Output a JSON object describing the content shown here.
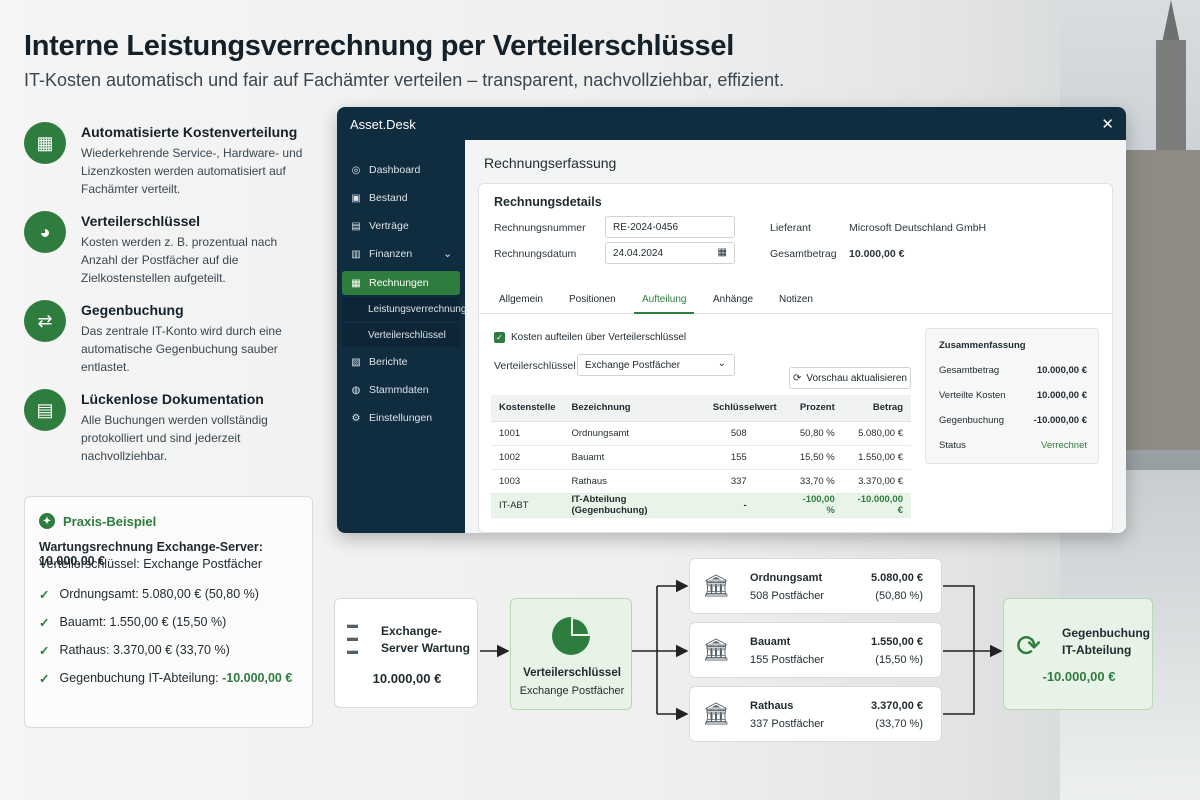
{
  "title": "Interne Leistungsverrechnung per Verteilerschlüssel",
  "subtitle": "IT-Kosten automatisch und fair auf Fachämter verteilen – transparent, nachvollziehbar, effizient.",
  "features": [
    {
      "title": "Automatisierte Kostenverteilung",
      "desc": "Wiederkehrende Service-, Hardware- und Lizenzkosten werden automatisiert auf Fachämter verteilt."
    },
    {
      "title": "Verteilerschlüssel",
      "desc": "Kosten werden z. B. prozentual nach Anzahl der Postfächer auf die Zielkostenstellen aufgeteilt."
    },
    {
      "title": "Gegenbuchung",
      "desc": "Das zentrale IT-Konto wird durch eine automatische Gegenbuchung sauber entlastet."
    },
    {
      "title": "Lückenlose Dokumentation",
      "desc": "Alle Buchungen werden vollständig protokolliert und sind jederzeit nachvollziehbar."
    }
  ],
  "example": {
    "heading": "Praxis-Beispiel",
    "line1": "Wartungsrechnung Exchange-Server: 10.000,00 €",
    "line2": "Verteilerschlüssel: Exchange Postfächer",
    "items": [
      "Ordnungsamt: 5.080,00 € (50,80 %)",
      "Bauamt: 1.550,00 € (15,50 %)",
      "Rathaus: 3.370,00 € (33,70 %)"
    ],
    "last_prefix": "Gegenbuchung IT-Abteilung: ",
    "last_value": "-10.000,00 €"
  },
  "app": {
    "name": "Asset.Desk",
    "close": "✕",
    "nav": [
      "Dashboard",
      "Bestand",
      "Verträge",
      "Finanzen",
      "Rechnungen",
      "Berichte",
      "Stammdaten",
      "Einstellungen"
    ],
    "subnav": [
      "Leistungsverrechnung",
      "Verteilerschlüssel"
    ],
    "page_title": "Rechnungserfassung",
    "card_title": "Rechnungsdetails",
    "lbl_nr": "Rechnungsnummer",
    "val_nr": "RE-2024-0456",
    "lbl_datum": "Rechnungsdatum",
    "val_datum": "24.04.2024",
    "lbl_lief": "Lieferant",
    "val_lief": "Microsoft Deutschland GmbH",
    "lbl_ges": "Gesamtbetrag",
    "val_ges": "10.000,00 €",
    "tabs": [
      "Allgemein",
      "Positionen",
      "Aufteilung",
      "Anhänge",
      "Notizen"
    ],
    "checkbox": "Kosten aufteilen über Verteilerschlüssel",
    "lbl_key": "Verteilerschlüssel",
    "val_key": "Exchange Postfächer",
    "refresh": "Vorschau aktualisieren",
    "table": {
      "headers": [
        "Kostenstelle",
        "Bezeichnung",
        "Schlüsselwert",
        "Prozent",
        "Betrag"
      ],
      "rows": [
        [
          "1001",
          "Ordnungsamt",
          "508",
          "50,80 %",
          "5.080,00 €"
        ],
        [
          "1002",
          "Bauamt",
          "155",
          "15,50 %",
          "1.550,00 €"
        ],
        [
          "1003",
          "Rathaus",
          "337",
          "33,70 %",
          "3.370,00 €"
        ],
        [
          "IT-ABT",
          "IT-Abteilung (Gegenbuchung)",
          "-",
          "-100,00 %",
          "-10.000,00 €"
        ]
      ]
    },
    "summary": {
      "title": "Zusammenfassung",
      "rows": [
        [
          "Gesamtbetrag",
          "10.000,00 €"
        ],
        [
          "Verteilte Kosten",
          "10.000,00 €"
        ],
        [
          "Gegenbuchung",
          "-10.000,00 €"
        ],
        [
          "Status",
          "Verrechnet"
        ]
      ]
    }
  },
  "flow": {
    "src_title": "Exchange-Server Wartung",
    "src_amount": "10.000,00 €",
    "key_title": "Verteilerschlüssel",
    "key_sub": "Exchange Postfächer",
    "targets": [
      {
        "name": "Ordnungsamt",
        "boxes": "508 Postfächer",
        "amount": "5.080,00 €",
        "pct": "(50,80 %)"
      },
      {
        "name": "Bauamt",
        "boxes": "155 Postfächer",
        "amount": "1.550,00 €",
        "pct": "(15,50 %)"
      },
      {
        "name": "Rathaus",
        "boxes": "337 Postfächer",
        "amount": "3.370,00 €",
        "pct": "(33,70 %)"
      }
    ],
    "dst_title": "Gegenbuchung IT-Abteilung",
    "dst_amount": "-10.000,00 €"
  },
  "colors": {
    "accent": "#2e7d3e",
    "navy": "#102c3f"
  }
}
